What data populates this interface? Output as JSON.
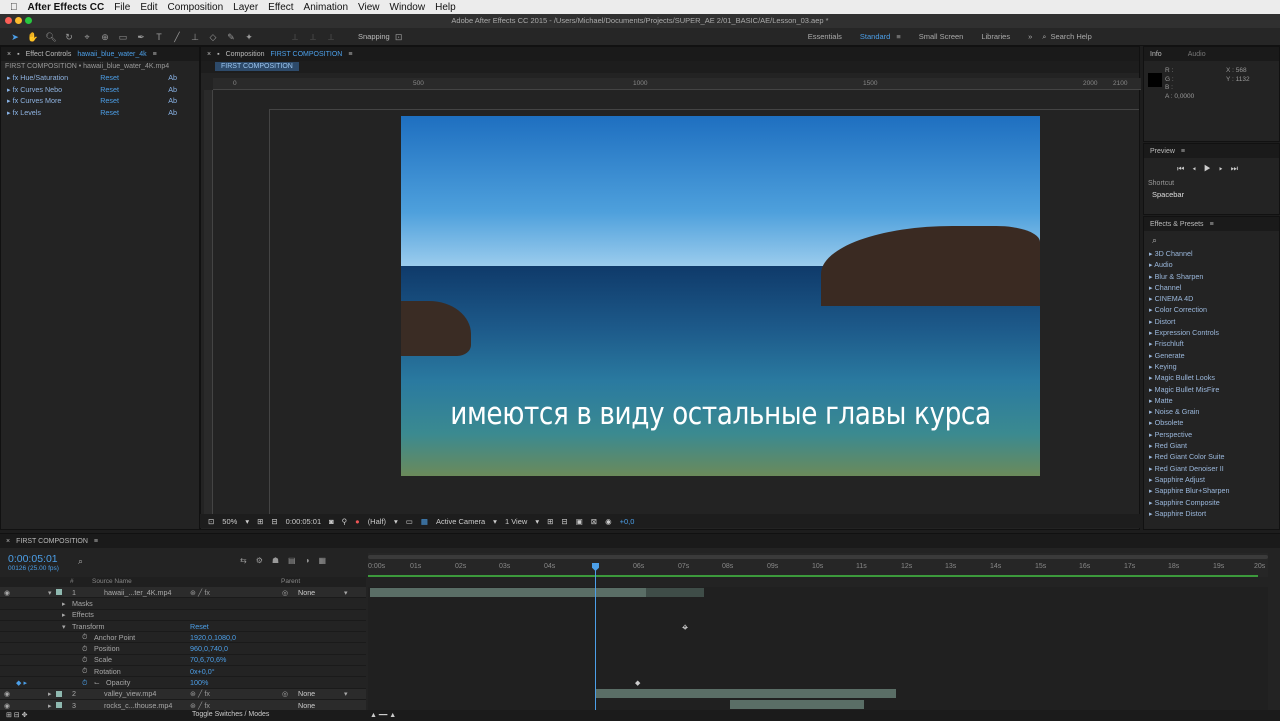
{
  "menubar": {
    "app": "After Effects CC",
    "items": [
      "File",
      "Edit",
      "Composition",
      "Layer",
      "Effect",
      "Animation",
      "View",
      "Window",
      "Help"
    ]
  },
  "titlebar": {
    "title": "Adobe After Effects CC 2015 - /Users/Michael/Documents/Projects/SUPER_AE 2/01_BASIC/AE/Lesson_03.aep *"
  },
  "toolbar": {
    "snapping": "Snapping",
    "workspaces": [
      "Essentials",
      "Standard",
      "Small Screen",
      "Libraries"
    ],
    "active_workspace": "Standard",
    "search_help": "Search Help"
  },
  "effect_controls": {
    "tab_label": "Effect Controls",
    "tab_layer": "hawaii_blue_water_4k",
    "breadcrumb": "FIRST COMPOSITION • hawaii_blue_water_4K.mp4",
    "effects": [
      {
        "name": "Hue/Saturation",
        "reset": "Reset",
        "extra": "Ab"
      },
      {
        "name": "Curves Nebo",
        "reset": "Reset",
        "extra": "Ab"
      },
      {
        "name": "Curves More",
        "reset": "Reset",
        "extra": "Ab"
      },
      {
        "name": "Levels",
        "reset": "Reset",
        "extra": "Ab"
      }
    ]
  },
  "composition": {
    "tab_prefix": "Composition",
    "tab_name": "FIRST COMPOSITION",
    "subtab": "FIRST COMPOSITION",
    "ruler_labels": [
      "0",
      "500",
      "1000",
      "1500",
      "2000",
      "2100"
    ],
    "subtitle": "имеются в виду остальные главы курса"
  },
  "viewer_bar": {
    "zoom": "50%",
    "timecode": "0:00:05:01",
    "resolution": "(Half)",
    "camera": "Active Camera",
    "views": "1 View",
    "exposure": "+0,0"
  },
  "info": {
    "tab": "Info",
    "tab2": "Audio",
    "r": "R :",
    "g": "G :",
    "b": "B :",
    "a": "A : 0,0000",
    "x": "X : 568",
    "y": "Y : 1132"
  },
  "preview": {
    "title": "Preview",
    "shortcut_label": "Shortcut",
    "shortcut_value": "Spacebar"
  },
  "effects_presets": {
    "title": "Effects & Presets",
    "items": [
      "3D Channel",
      "Audio",
      "Blur & Sharpen",
      "Channel",
      "CINEMA 4D",
      "Color Correction",
      "Distort",
      "Expression Controls",
      "Frischluft",
      "Generate",
      "Keying",
      "Magic Bullet Looks",
      "Magic Bullet MisFire",
      "Matte",
      "Noise & Grain",
      "Obsolete",
      "Perspective",
      "Red Giant",
      "Red Giant Color Suite",
      "Red Giant Denoiser II",
      "Sapphire Adjust",
      "Sapphire Blur+Sharpen",
      "Sapphire Composite",
      "Sapphire Distort"
    ]
  },
  "timeline": {
    "tab": "FIRST COMPOSITION",
    "timecode": "0:00:05:01",
    "frame_info": "00126 (25.00 fps)",
    "col_source": "Source Name",
    "col_parent": "Parent",
    "col_hash": "#",
    "ticks": [
      "0:00s",
      "01s",
      "02s",
      "03s",
      "04s",
      "",
      "06s",
      "07s",
      "08s",
      "09s",
      "10s",
      "11s",
      "12s",
      "13s",
      "14s",
      "15s",
      "16s",
      "17s",
      "18s",
      "19s",
      "20s"
    ],
    "rows": [
      {
        "num": "1",
        "name": "hawaii_...ter_4K.mp4",
        "parent": "None",
        "value": ""
      },
      {
        "num": "",
        "name": "Masks",
        "parent": "",
        "value": ""
      },
      {
        "num": "",
        "name": "Effects",
        "parent": "",
        "value": ""
      },
      {
        "num": "",
        "name": "Transform",
        "parent": "",
        "value": "Reset"
      },
      {
        "num": "",
        "name": "Anchor Point",
        "parent": "",
        "value": "1920,0,1080,0"
      },
      {
        "num": "",
        "name": "Position",
        "parent": "",
        "value": "960,0,740,0"
      },
      {
        "num": "",
        "name": "Scale",
        "parent": "",
        "value": "70,6,70,6%"
      },
      {
        "num": "",
        "name": "Rotation",
        "parent": "",
        "value": "0x+0,0°"
      },
      {
        "num": "",
        "name": "Opacity",
        "parent": "",
        "value": "100%"
      },
      {
        "num": "2",
        "name": "valley_view.mp4",
        "parent": "None",
        "value": ""
      },
      {
        "num": "3",
        "name": "rocks_c...thouse.mp4",
        "parent": "None",
        "value": ""
      }
    ],
    "toggle": "Toggle Switches / Modes"
  }
}
